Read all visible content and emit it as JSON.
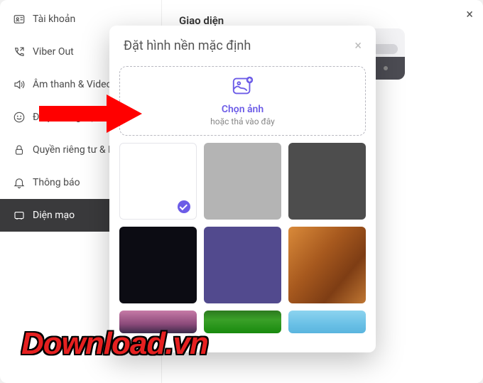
{
  "window": {
    "close": "×"
  },
  "sidebar": {
    "items": [
      {
        "label": "Tài khoản"
      },
      {
        "label": "Viber Out"
      },
      {
        "label": "Âm thanh & Video"
      },
      {
        "label": "Đa phương tiện"
      },
      {
        "label": "Quyền riêng tư & Bảo mật"
      },
      {
        "label": "Thông báo"
      },
      {
        "label": "Diện mạo"
      }
    ]
  },
  "main": {
    "title": "Giao diện"
  },
  "modal": {
    "title": "Đặt hình nền mặc định",
    "close": "×",
    "dropzone": {
      "label": "Chọn ảnh",
      "sub": "hoặc thả vào đây"
    }
  },
  "watermark": "Download.vn"
}
